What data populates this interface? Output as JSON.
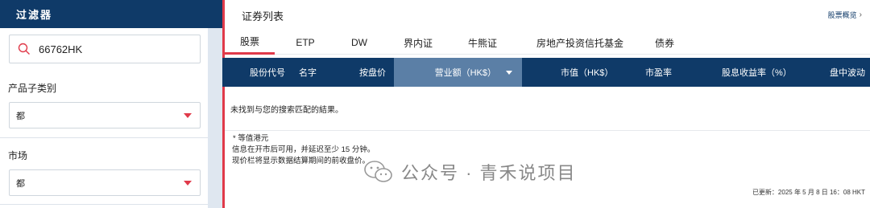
{
  "sidebar": {
    "title": "过滤器",
    "search": {
      "value": "66762HK"
    },
    "filters": [
      {
        "label": "产品子类别",
        "selected": "都"
      },
      {
        "label": "市场",
        "selected": "都"
      }
    ]
  },
  "main": {
    "title": "证券列表",
    "overview_link": "股票概览",
    "tabs": [
      {
        "label": "股票",
        "active": true
      },
      {
        "label": "ETP"
      },
      {
        "label": "DW"
      },
      {
        "label": "界内证"
      },
      {
        "label": "牛熊证"
      },
      {
        "label": "房地产投资信托基金"
      },
      {
        "label": "债券"
      }
    ],
    "columns": [
      {
        "label": "股份代号"
      },
      {
        "label": "名字"
      },
      {
        "label": "按盘价"
      },
      {
        "label": "营业额（HK$）",
        "sorted": true
      },
      {
        "label": "市值（HK$）"
      },
      {
        "label": "市盈率"
      },
      {
        "label": "股息收益率（%）"
      },
      {
        "label": "盘中波动"
      }
    ],
    "empty_message": "未找到与您的搜索匹配的結果。",
    "notes": [
      "* 等值港元",
      "信息在开市后可用，并延迟至少 15 分钟。",
      "现价栏将显示数据结算期间的前收盘价。"
    ],
    "updated": "已更新：2025 年 5 月 8 日 16：08 HKT"
  },
  "watermark": {
    "text": "公众号 · 青禾说项目"
  },
  "colors": {
    "navy": "#0f3a68",
    "accent": "#e03a4a",
    "sorted_header": "#5b7fa6"
  }
}
